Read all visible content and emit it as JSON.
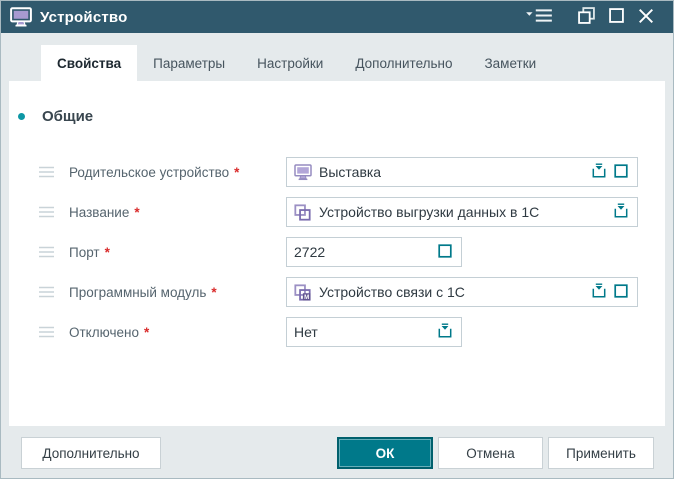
{
  "window": {
    "title": "Устройство"
  },
  "titlebar_controls": {
    "menu": "window-menu",
    "restore": "restore",
    "maximize": "maximize",
    "close": "close"
  },
  "tabs": [
    {
      "label": "Свойства",
      "active": true
    },
    {
      "label": "Параметры",
      "active": false
    },
    {
      "label": "Настройки",
      "active": false
    },
    {
      "label": "Дополнительно",
      "active": false
    },
    {
      "label": "Заметки",
      "active": false
    }
  ],
  "section": {
    "title": "Общие"
  },
  "required_marker": "*",
  "fields": {
    "parent_device": {
      "label": "Родительское устройство",
      "value": "Выставка",
      "required": true
    },
    "name": {
      "label": "Название",
      "value": "Устройство выгрузки данных в 1С",
      "required": true
    },
    "port": {
      "label": "Порт",
      "value": "2722",
      "required": true
    },
    "program_module": {
      "label": "Программный модуль",
      "value": "Устройство связи с 1С",
      "required": true
    },
    "disabled": {
      "label": "Отключено",
      "value": "Нет",
      "required": true
    }
  },
  "footer": {
    "additional": "Дополнительно",
    "ok": "ОК",
    "cancel": "Отмена",
    "apply": "Применить"
  },
  "icons": {
    "module_badge": "M"
  },
  "colors": {
    "titlebar": "#30596d",
    "accent_teal": "#00798a",
    "section_bullet": "#0d97a5",
    "required_red": "#d92b2b",
    "icon_purple": "#958cc0",
    "window_bg": "#e5eaec"
  }
}
